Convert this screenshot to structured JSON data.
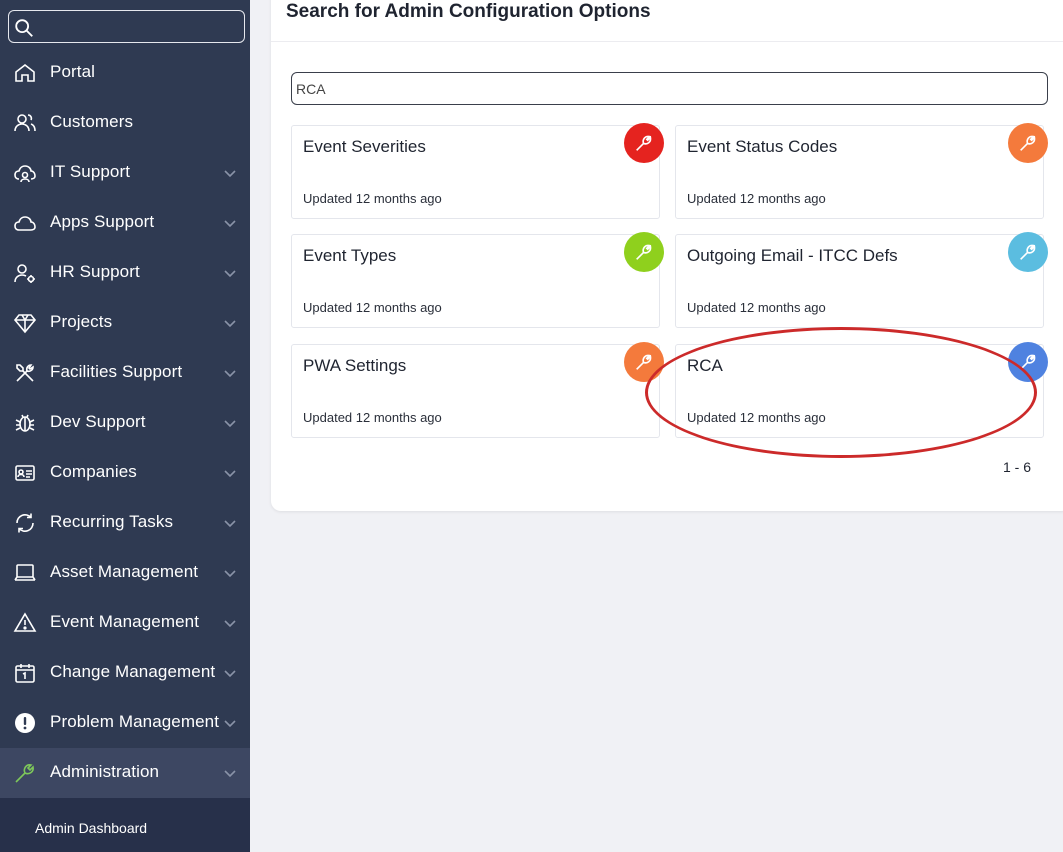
{
  "sidebar": {
    "search_placeholder": "",
    "items": [
      {
        "label": "Portal",
        "icon": "home-icon",
        "has_chevron": false
      },
      {
        "label": "Customers",
        "icon": "users-icon",
        "has_chevron": false
      },
      {
        "label": "IT Support",
        "icon": "cloud-user-icon",
        "has_chevron": true
      },
      {
        "label": "Apps Support",
        "icon": "cloud-icon",
        "has_chevron": true
      },
      {
        "label": "HR Support",
        "icon": "user-gear-icon",
        "has_chevron": true
      },
      {
        "label": "Projects",
        "icon": "diamond-icon",
        "has_chevron": true
      },
      {
        "label": "Facilities Support",
        "icon": "tools-icon",
        "has_chevron": true
      },
      {
        "label": "Dev Support",
        "icon": "bug-icon",
        "has_chevron": true
      },
      {
        "label": "Companies",
        "icon": "id-card-icon",
        "has_chevron": true
      },
      {
        "label": "Recurring Tasks",
        "icon": "refresh-icon",
        "has_chevron": true
      },
      {
        "label": "Asset Management",
        "icon": "laptop-icon",
        "has_chevron": true
      },
      {
        "label": "Event Management",
        "icon": "warning-icon",
        "has_chevron": true
      },
      {
        "label": "Change Management",
        "icon": "calendar-icon",
        "has_chevron": true
      },
      {
        "label": "Problem Management",
        "icon": "exclamation-circle-icon",
        "has_chevron": true
      },
      {
        "label": "Administration",
        "icon": "wrench-icon",
        "has_chevron": true,
        "active": true
      }
    ],
    "sub_items": [
      {
        "label": "Admin Dashboard"
      }
    ]
  },
  "main": {
    "title": "Search for Admin Configuration Options",
    "search_value": "RCA",
    "cards": [
      {
        "title": "Event Severities",
        "updated": "Updated 12 months ago",
        "badge_color": "#e5231f"
      },
      {
        "title": "Event Status Codes",
        "updated": "Updated 12 months ago",
        "badge_color": "#f47a3c"
      },
      {
        "title": "Event Types",
        "updated": "Updated 12 months ago",
        "badge_color": "#8fd01d"
      },
      {
        "title": "Outgoing Email - ITCC Defs",
        "updated": "Updated 12 months ago",
        "badge_color": "#5bbde0"
      },
      {
        "title": "PWA Settings",
        "updated": "Updated 12 months ago",
        "badge_color": "#f47a3c"
      },
      {
        "title": "RCA",
        "updated": "Updated 12 months ago",
        "badge_color": "#4f82e0"
      }
    ],
    "pagination": "1 - 6"
  },
  "colors": {
    "sidebar_bg": "#2f3a52",
    "sidebar_active_bg": "#3d4762",
    "active_icon": "#7ec85a",
    "annotation": "#cc2a2a"
  }
}
